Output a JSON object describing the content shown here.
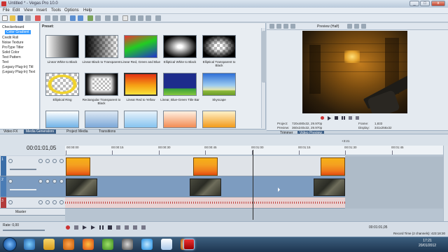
{
  "window": {
    "title": "Untitled * - Vegas Pro 10.0",
    "controls": [
      "_",
      "□",
      "x"
    ]
  },
  "menu": [
    "File",
    "Edit",
    "View",
    "Insert",
    "Tools",
    "Options",
    "Help"
  ],
  "tree": {
    "items": [
      "Checkerboard",
      "Color Gradient",
      "Credit Roll",
      "Noise Texture",
      "ProType Titler",
      "Solid Color",
      "Test Pattern",
      "Text",
      "(Legacy Plug-In) Titl",
      "(Legacy Plug-In) Text"
    ],
    "selected": "Color Gradient"
  },
  "presets": {
    "label": "Preset:",
    "items": [
      "Linear White to Black",
      "Linear Black to Transparent",
      "Linear Red, Green and Blue",
      "Elliptical White to Black",
      "Elliptical Transparent to Black",
      "Elliptical Ring",
      "Rectangular Transparent to Black",
      "Linear Red to Yellow",
      "Linear, Blue-Green Title Bar",
      "Skyscape",
      "",
      "",
      "",
      "",
      ""
    ]
  },
  "left_tabs": [
    "Video FX",
    "Media Generators",
    "Project Media",
    "Transitions"
  ],
  "left_tabs_active": "Media Generators",
  "preview": {
    "mode_label": "Preview (Half)",
    "info": {
      "project_label": "Project:",
      "project": "720x480x32, 29.970p",
      "preview_label": "Preview:",
      "preview": "360x240x32, 29.970p",
      "frame_label": "Frame:",
      "frame": "1,833",
      "display_label": "Display:",
      "display": "341x256x32"
    },
    "tabs": [
      "Trimmer",
      "Video Preview"
    ],
    "tabs_active": "Video Preview"
  },
  "timeline": {
    "timecode": "00:01:01,05",
    "ruler": [
      "00:00:00",
      "00:00:15",
      "00:00:30",
      "00:00:45",
      "00:01:00",
      "00:01:15",
      "00:01:30",
      "00:01:45"
    ],
    "ruler_marker": "+3:21",
    "tracks": [
      {
        "number": "1",
        "color": "#3b6ea8"
      },
      {
        "number": "2",
        "color": "#4a7cb5"
      },
      {
        "number": "3",
        "color": "#b23b3b"
      }
    ],
    "master_label": "Master",
    "rate_label": "Rate: 0,00",
    "bottom_timecode": "00:01:01,05",
    "record_time": "Record Time (2 channels): 423:18:30"
  },
  "taskbar": {
    "time": "17:21",
    "date": "20/01/2012",
    "icons": [
      "start-orb",
      "internet-explorer-icon",
      "explorer-icon",
      "media-player-icon",
      "firefox-icon",
      "utorrent-icon",
      "steam-icon",
      "skype-icon",
      "paint-icon",
      "winamp-icon",
      "youtube-icon",
      "vegas-icon"
    ]
  },
  "colors": {
    "accent": "#3399ff",
    "track_video": "#7d9cc0",
    "clip_orange": "#f4a020"
  }
}
